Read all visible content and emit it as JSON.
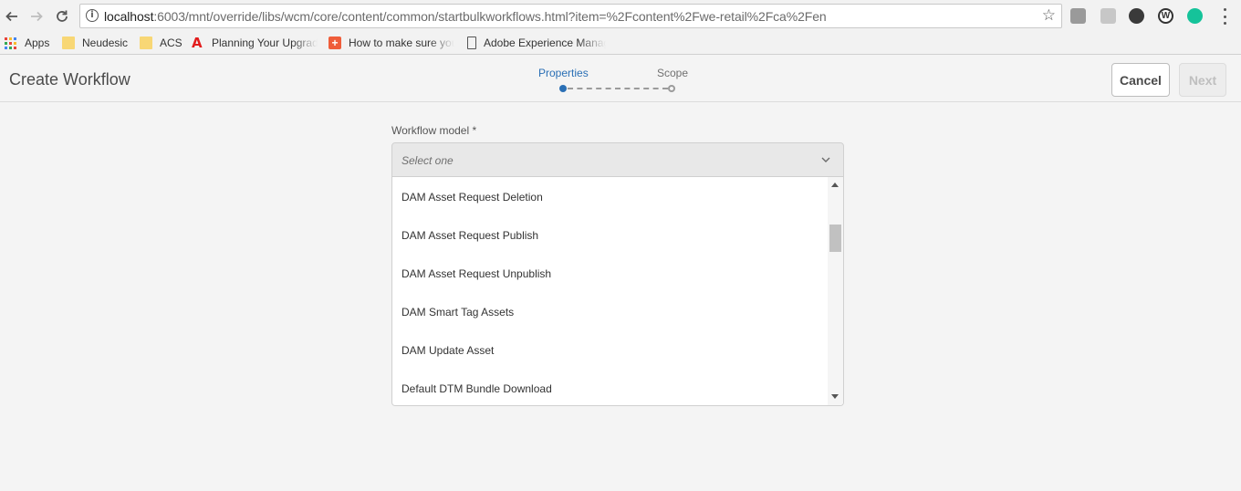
{
  "browser": {
    "url_host": "localhost",
    "url_path": ":6003/mnt/override/libs/wcm/core/content/common/startbulkworkflows.html?item=%2Fcontent%2Fwe-retail%2Fca%2Fen",
    "ext_w_label": "W",
    "icons": [
      "back-icon",
      "forward-icon",
      "reload-icon",
      "info-icon",
      "star-icon",
      "menu-icon"
    ]
  },
  "bookmarks": [
    {
      "label": "Apps",
      "icon": "apps-icon"
    },
    {
      "label": "Neudesic",
      "icon": "folder-icon"
    },
    {
      "label": "ACS",
      "icon": "folder-icon"
    },
    {
      "label": "Planning Your Upgrade",
      "icon": "adobe-icon"
    },
    {
      "label": "How to make sure your",
      "icon": "plus-icon"
    },
    {
      "label": "Adobe Experience Manager",
      "icon": "page-icon"
    }
  ],
  "header": {
    "title": "Create Workflow",
    "steps": [
      "Properties",
      "Scope"
    ],
    "active_step": "Properties",
    "cancel_label": "Cancel",
    "next_label": "Next"
  },
  "form": {
    "field_label": "Workflow model *",
    "select_placeholder": "Select one",
    "options": [
      "DAM Asset Request Deletion",
      "DAM Asset Request Publish",
      "DAM Asset Request Unpublish",
      "DAM Smart Tag Assets",
      "DAM Update Asset",
      "Default DTM Bundle Download"
    ]
  },
  "colors": {
    "accent": "#2a6fb5",
    "background": "#f4f4f4"
  }
}
